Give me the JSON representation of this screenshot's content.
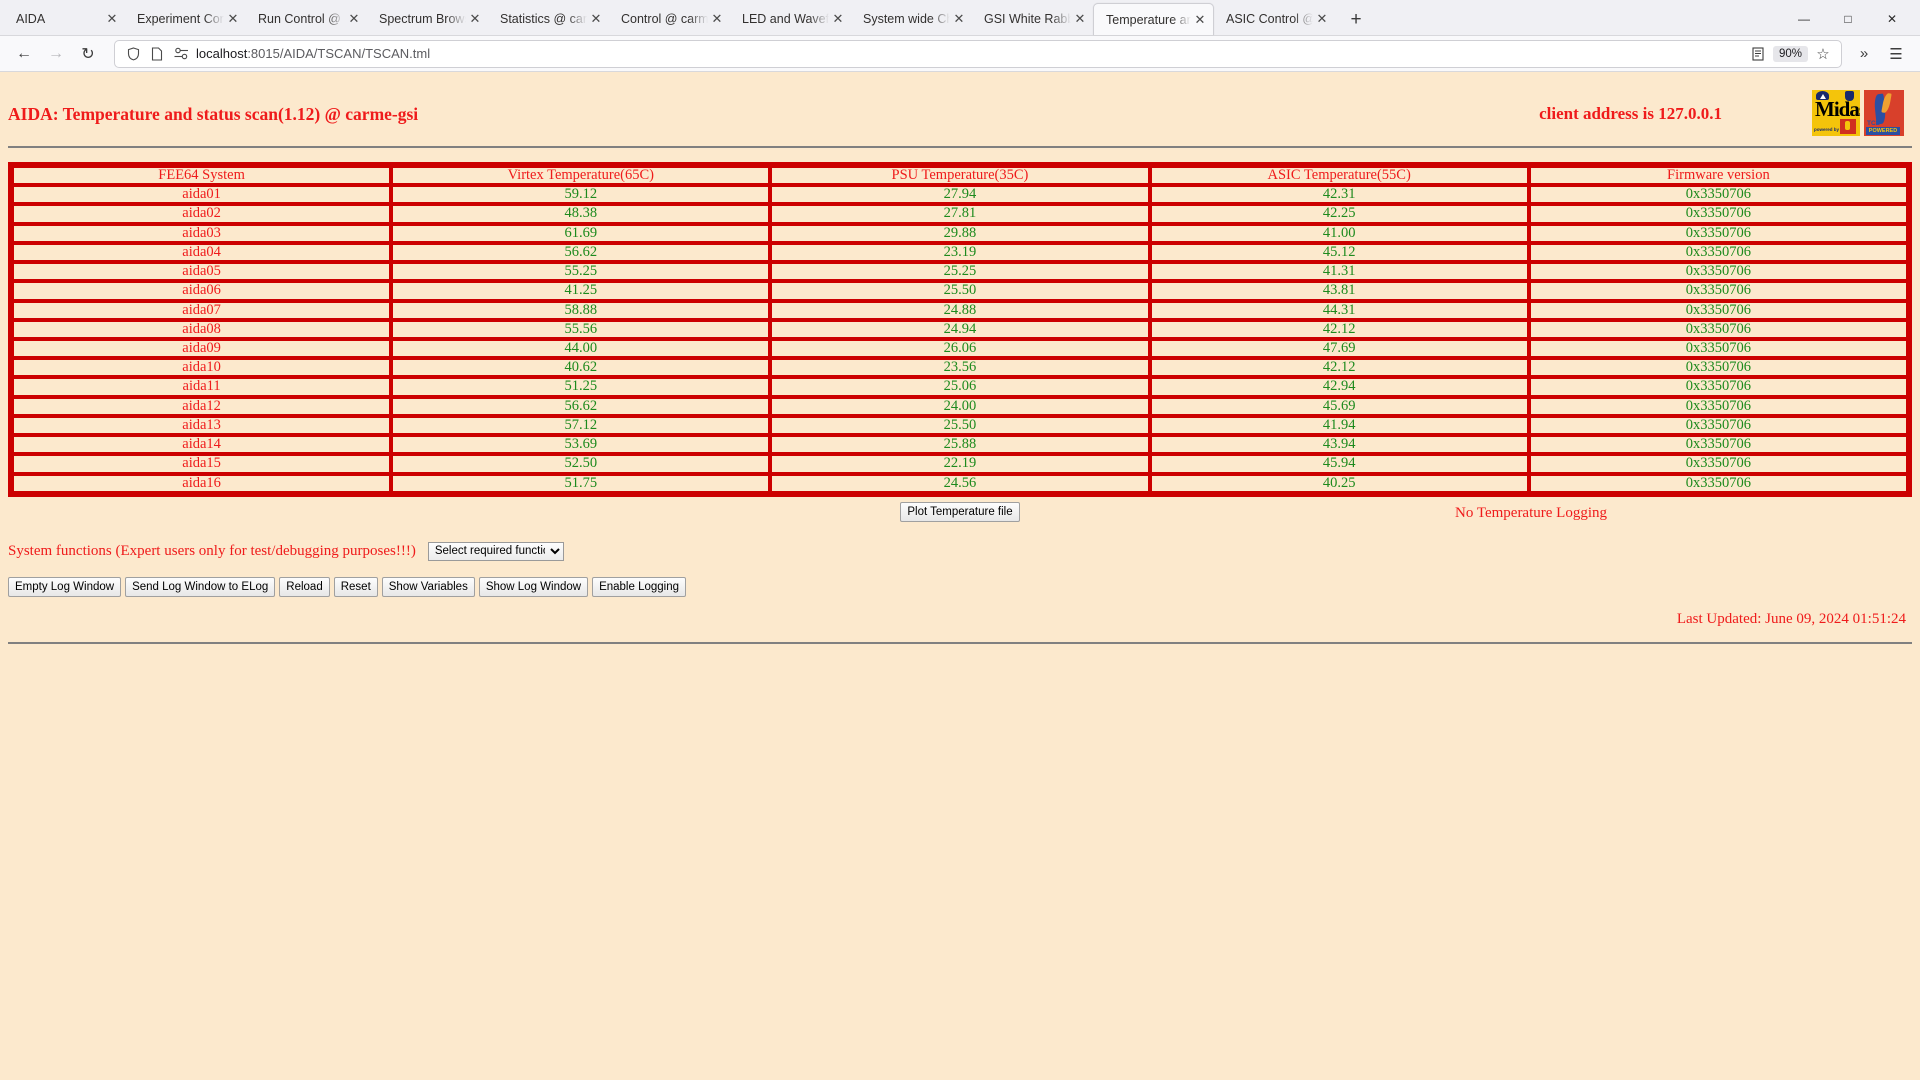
{
  "browser": {
    "tabs": [
      {
        "label": "AIDA",
        "active": false
      },
      {
        "label": "Experiment Control",
        "active": false
      },
      {
        "label": "Run Control @ carme",
        "active": false
      },
      {
        "label": "Spectrum Browser",
        "active": false
      },
      {
        "label": "Statistics @ carme",
        "active": false
      },
      {
        "label": "Control @ carme-gsi",
        "active": false
      },
      {
        "label": "LED and Waveform",
        "active": false
      },
      {
        "label": "System wide Check",
        "active": false
      },
      {
        "label": "GSI White Rabbit Ti",
        "active": false
      },
      {
        "label": "Temperature and st",
        "active": true
      },
      {
        "label": "ASIC Control @ car",
        "active": false
      }
    ],
    "new_tab_label": "+",
    "close_label": "✕",
    "window_controls": {
      "minimize": "—",
      "maximize": "□",
      "close": "✕"
    },
    "nav": {
      "back": "←",
      "forward": "→",
      "reload": "↻"
    },
    "url": {
      "host": "localhost",
      "rest": ":8015/AIDA/TSCAN/TSCAN.tml"
    },
    "zoom": "90%",
    "icons": {
      "shield": "shield-icon",
      "page": "page-icon",
      "permissions": "permissions-icon",
      "reader": "reader-view-icon",
      "bookmark": "☆",
      "overflow": "»",
      "menu": "☰"
    }
  },
  "page": {
    "title": "AIDA: Temperature and status scan(1.12) @ carme-gsi",
    "client_address": "client address is 127.0.0.1",
    "logos": {
      "midas": {
        "text": "Midas",
        "subtext": "powered by",
        "name": "midas-logo"
      },
      "tcl": {
        "label": "TCL",
        "powered": "POWERED",
        "name": "tcl-powered-logo"
      }
    },
    "table": {
      "headers": [
        "FEE64 System",
        "Virtex Temperature(65C)",
        "PSU Temperature(35C)",
        "ASIC Temperature(55C)",
        "Firmware version"
      ],
      "rows": [
        {
          "system": "aida01",
          "virtex": "59.12",
          "psu": "27.94",
          "asic": "42.31",
          "firmware": "0x3350706"
        },
        {
          "system": "aida02",
          "virtex": "48.38",
          "psu": "27.81",
          "asic": "42.25",
          "firmware": "0x3350706"
        },
        {
          "system": "aida03",
          "virtex": "61.69",
          "psu": "29.88",
          "asic": "41.00",
          "firmware": "0x3350706"
        },
        {
          "system": "aida04",
          "virtex": "56.62",
          "psu": "23.19",
          "asic": "45.12",
          "firmware": "0x3350706"
        },
        {
          "system": "aida05",
          "virtex": "55.25",
          "psu": "25.25",
          "asic": "41.31",
          "firmware": "0x3350706"
        },
        {
          "system": "aida06",
          "virtex": "41.25",
          "psu": "25.50",
          "asic": "43.81",
          "firmware": "0x3350706"
        },
        {
          "system": "aida07",
          "virtex": "58.88",
          "psu": "24.88",
          "asic": "44.31",
          "firmware": "0x3350706"
        },
        {
          "system": "aida08",
          "virtex": "55.56",
          "psu": "24.94",
          "asic": "42.12",
          "firmware": "0x3350706"
        },
        {
          "system": "aida09",
          "virtex": "44.00",
          "psu": "26.06",
          "asic": "47.69",
          "firmware": "0x3350706"
        },
        {
          "system": "aida10",
          "virtex": "40.62",
          "psu": "23.56",
          "asic": "42.12",
          "firmware": "0x3350706"
        },
        {
          "system": "aida11",
          "virtex": "51.25",
          "psu": "25.06",
          "asic": "42.94",
          "firmware": "0x3350706"
        },
        {
          "system": "aida12",
          "virtex": "56.62",
          "psu": "24.00",
          "asic": "45.69",
          "firmware": "0x3350706"
        },
        {
          "system": "aida13",
          "virtex": "57.12",
          "psu": "25.50",
          "asic": "41.94",
          "firmware": "0x3350706"
        },
        {
          "system": "aida14",
          "virtex": "53.69",
          "psu": "25.88",
          "asic": "43.94",
          "firmware": "0x3350706"
        },
        {
          "system": "aida15",
          "virtex": "52.50",
          "psu": "22.19",
          "asic": "45.94",
          "firmware": "0x3350706"
        },
        {
          "system": "aida16",
          "virtex": "51.75",
          "psu": "24.56",
          "asic": "40.25",
          "firmware": "0x3350706"
        }
      ]
    },
    "plot_button": "Plot Temperature file",
    "logging_status": "No Temperature Logging",
    "system_functions_label": "System functions (Expert users only for test/debugging purposes!!!)",
    "function_select": {
      "selected": "Select required function"
    },
    "buttons": [
      "Empty Log Window",
      "Send Log Window to ELog",
      "Reload",
      "Reset",
      "Show Variables",
      "Show Log Window",
      "Enable Logging"
    ],
    "last_updated": "Last Updated: June 09, 2024 01:51:24",
    "colors": {
      "background": "#fce9cd",
      "red": "#ef1b1b",
      "border_red": "#cc0000",
      "green": "#1d8a1d"
    }
  }
}
